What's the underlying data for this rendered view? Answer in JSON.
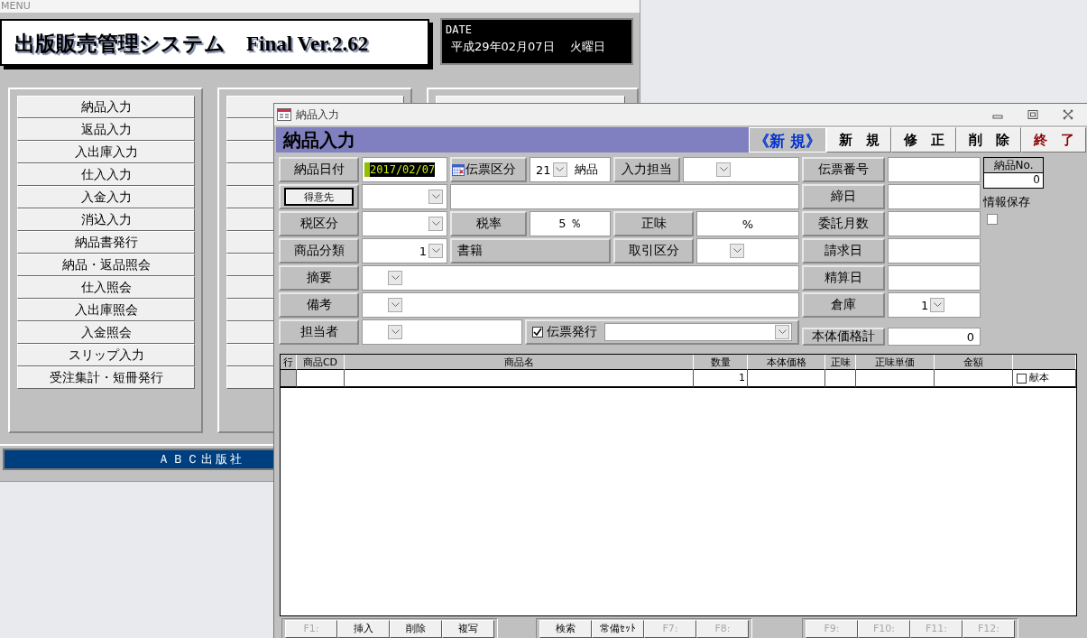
{
  "menu_window": {
    "title": "MENU",
    "app_title": "出版販売管理システム　Final Ver.2.62",
    "date_label": "DATE",
    "date": "平成29年02月07日　 火曜日",
    "menu_buttons": [
      "納品入力",
      "返品入力",
      "入出庫入力",
      "仕入入力",
      "入金入力",
      "消込入力",
      "納品書発行",
      "納品・返品照会",
      "仕入照会",
      "入出庫照会",
      "入金照会",
      "スリップ入力",
      "受注集計・短冊発行"
    ],
    "company": "ＡＢＣ出版社"
  },
  "dialog": {
    "title": "納品入力",
    "heading": "納品入力",
    "mode": "《新 規》",
    "actions": [
      {
        "label": "新　規",
        "kind": "normal"
      },
      {
        "label": "修　正",
        "kind": "normal"
      },
      {
        "label": "削　除",
        "kind": "normal"
      },
      {
        "label": "終　了",
        "kind": "exit"
      }
    ],
    "form": {
      "delivery_date": {
        "label": "納品日付",
        "value": "2017/02/07"
      },
      "slip_type": {
        "label": "伝票区分",
        "code": "21",
        "name": "納品"
      },
      "entry_staff": {
        "label": "入力担当"
      },
      "customer": {
        "button": "得意先"
      },
      "tax_type": {
        "label": "税区分"
      },
      "tax_rate": {
        "label": "税率",
        "value": "5 ％"
      },
      "net": {
        "label": "正味",
        "value": "%"
      },
      "product_class": {
        "label": "商品分類",
        "code": "1",
        "name": "書籍"
      },
      "trade_type": {
        "label": "取引区分"
      },
      "summary": {
        "label": "摘要"
      },
      "remarks": {
        "label": "備考"
      },
      "person": {
        "label": "担当者"
      },
      "slip_issue": {
        "label": "伝票発行",
        "checked": true
      }
    },
    "side_fields": [
      {
        "label": "伝票番号",
        "kind": "text"
      },
      {
        "label": "締日",
        "kind": "text"
      },
      {
        "label": "委託月数",
        "kind": "text"
      },
      {
        "label": "請求日",
        "kind": "text"
      },
      {
        "label": "精算日",
        "kind": "text"
      },
      {
        "label": "倉庫",
        "kind": "combo",
        "value": "1"
      }
    ],
    "total": {
      "label": "本体価格計",
      "value": "0"
    },
    "delivery_no": {
      "label": "納品No.",
      "value": "0"
    },
    "save_info": {
      "label": "情報保存",
      "checked": false
    },
    "table": {
      "columns": [
        "行",
        "商品CD",
        "商品名",
        "数量",
        "本体価格",
        "正味",
        "正味単価",
        "金額"
      ],
      "rows": [
        {
          "cells": [
            "",
            "",
            "",
            "1",
            "",
            "",
            "",
            ""
          ],
          "gift": {
            "label": "献本",
            "checked": false
          }
        }
      ]
    },
    "function_keys": [
      [
        {
          "label": "F1:",
          "disabled": true
        },
        {
          "label": "挿入",
          "disabled": false
        },
        {
          "label": "削除",
          "disabled": false
        },
        {
          "label": "複写",
          "disabled": false
        }
      ],
      [
        {
          "label": "検索",
          "disabled": false
        },
        {
          "label": "常備ｾｯﾄ",
          "disabled": false
        },
        {
          "label": "F7:",
          "disabled": true
        },
        {
          "label": "F8:",
          "disabled": true
        }
      ],
      [
        {
          "label": "F9:",
          "disabled": true
        },
        {
          "label": "F10:",
          "disabled": true
        },
        {
          "label": "F11:",
          "disabled": true
        },
        {
          "label": "F12:",
          "disabled": true
        }
      ]
    ]
  }
}
